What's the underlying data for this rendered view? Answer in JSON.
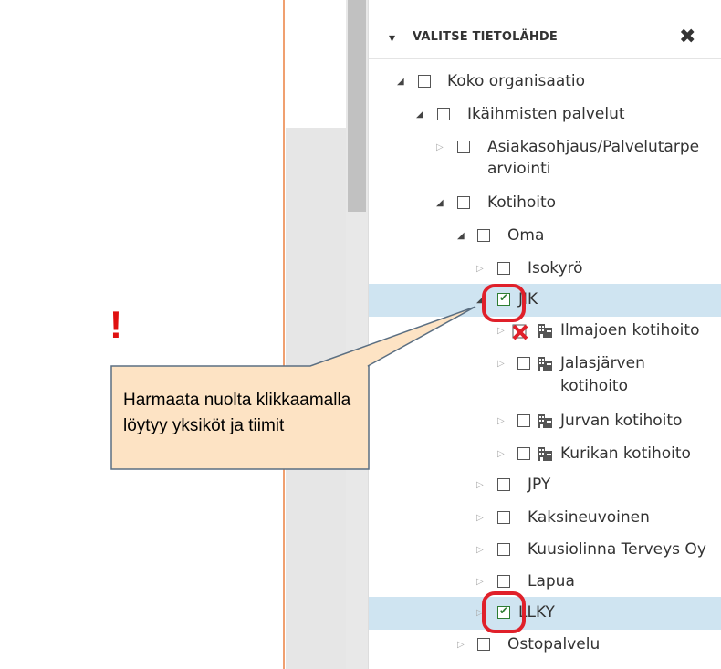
{
  "panel": {
    "title": "VALITSE TIETOLÄHDE",
    "close": "✖",
    "chevron": "▾"
  },
  "tree": [
    {
      "label": "Koko organisaatio",
      "toggle": "◢",
      "state": "open"
    },
    {
      "label": "Ikäihmisten palvelut",
      "toggle": "◢",
      "state": "open"
    },
    {
      "label": "Asiakasohjaus/Palvelutarpeen arviointi",
      "line1": "Asiakasohjaus/Palvelutarpe",
      "line2": "arviointi",
      "toggle": "▷",
      "state": "closed"
    },
    {
      "label": "Kotihoito",
      "toggle": "◢",
      "state": "open"
    },
    {
      "label": "Oma",
      "toggle": "◢",
      "state": "open"
    },
    {
      "label": "Isokyrö",
      "toggle": "▷",
      "state": "closed"
    },
    {
      "label": "JIK",
      "toggle": "◢",
      "state": "open",
      "checked": true
    },
    {
      "label": "Ilmajoen kotihoito",
      "toggle": "▷",
      "state": "closed"
    },
    {
      "label": "Jalasjärven kotihoito",
      "line1": "Jalasjärven",
      "line2": "kotihoito",
      "toggle": "▷",
      "state": "closed"
    },
    {
      "label": "Jurvan kotihoito",
      "toggle": "▷",
      "state": "closed"
    },
    {
      "label": "Kurikan kotihoito",
      "toggle": "▷",
      "state": "closed"
    },
    {
      "label": "JPY",
      "toggle": "▷",
      "state": "closed"
    },
    {
      "label": "Kaksineuvoinen",
      "toggle": "▷",
      "state": "closed"
    },
    {
      "label": "Kuusiolinna Terveys Oy",
      "toggle": "▷",
      "state": "closed"
    },
    {
      "label": "Lapua",
      "toggle": "▷",
      "state": "closed"
    },
    {
      "label": "LLKY",
      "toggle": "▷",
      "state": "closed",
      "checked": true
    },
    {
      "label": "Ostopalvelu",
      "toggle": "▷",
      "state": "closed"
    }
  ],
  "annotation": {
    "exclamation": "!",
    "callout_line1": "Harmaata nuolta klikkaamalla",
    "callout_line2": "löytyy yksiköt ja tiimit"
  },
  "colors": {
    "selected_row": "#cfe4f1",
    "highlight_red": "#e0202a",
    "callout_fill": "#fde3c4",
    "check_green": "#2e7d32"
  }
}
